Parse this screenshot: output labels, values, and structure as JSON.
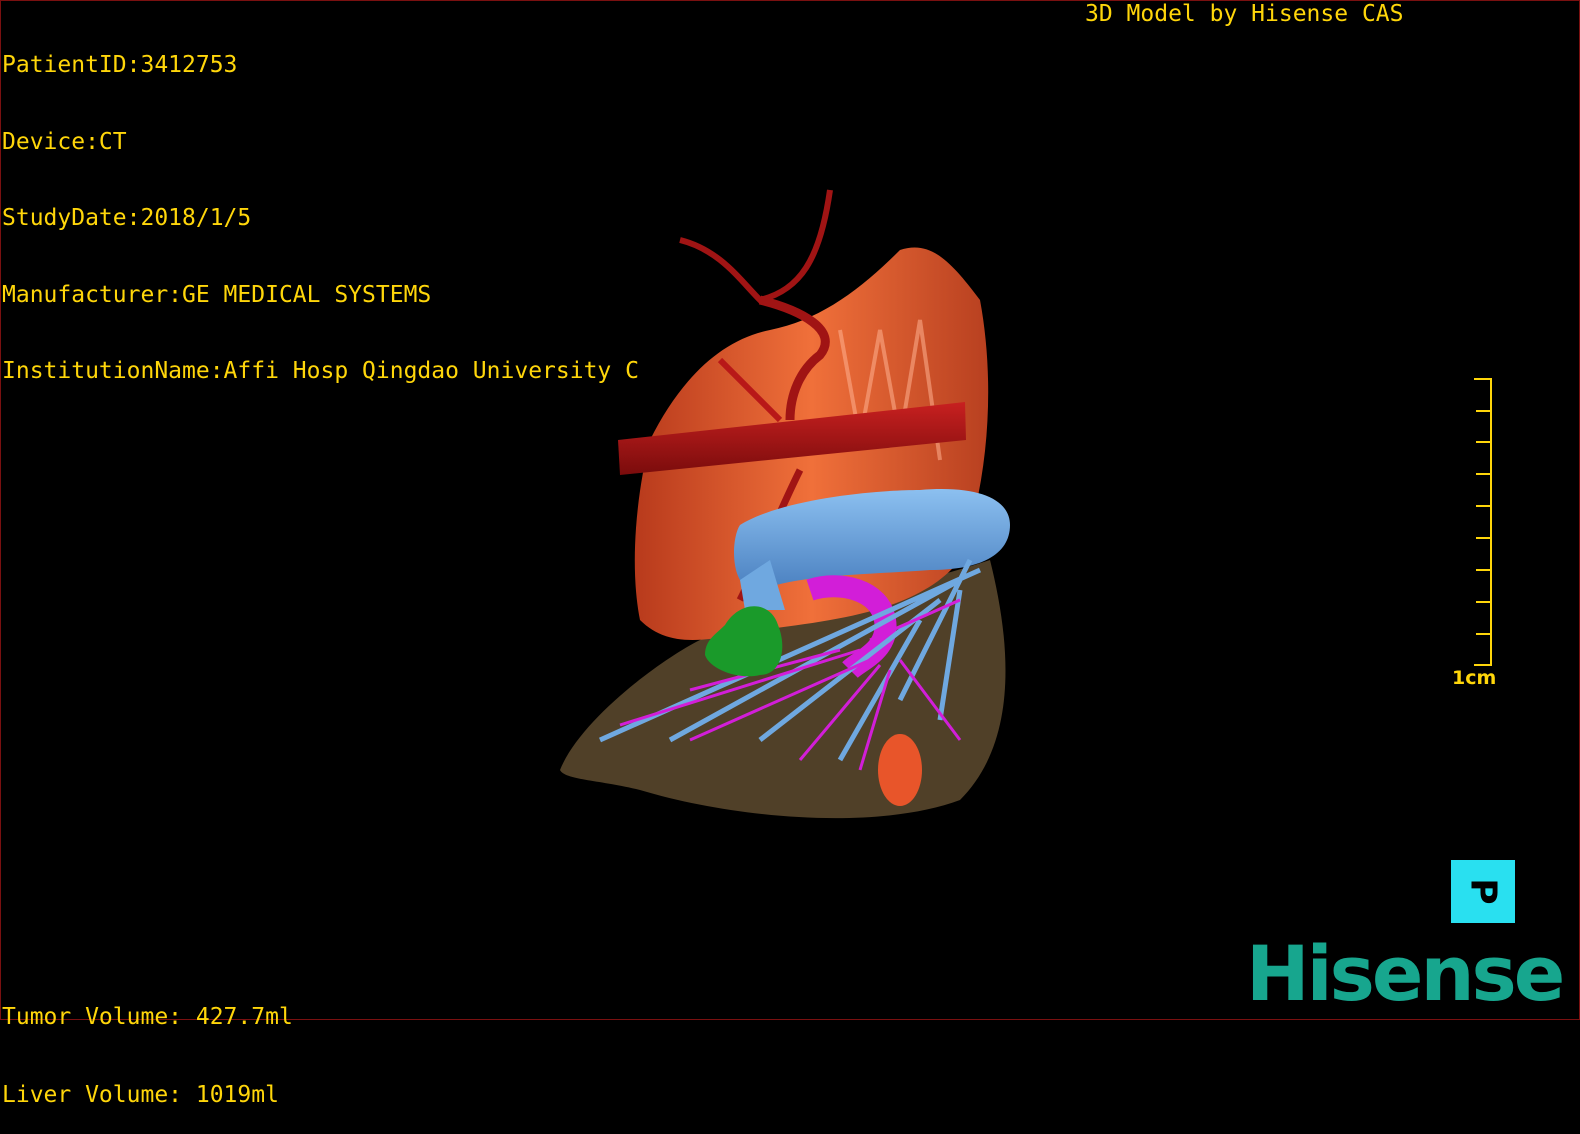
{
  "header": {
    "patient_id": "PatientID:3412753",
    "device": "Device:CT",
    "study_date": "StudyDate:2018/1/5",
    "manufacturer": "Manufacturer:GE MEDICAL SYSTEMS",
    "institution": "InstitutionName:Affi Hosp Qingdao University C",
    "credit": "3D Model by Hisense CAS"
  },
  "volumes": {
    "tumor": "Tumor Volume: 427.7ml",
    "liver": "Liver Volume: 1019ml"
  },
  "scale_bar": {
    "label": "1cm"
  },
  "orientation_marker": {
    "label": "P"
  },
  "brand": {
    "logo_text": "Hisense",
    "color": "#17a68e"
  },
  "colors": {
    "overlay_text": "#ffd60a",
    "liver": "#d8562e",
    "artery": "#a01414",
    "portal_vein": "#6fa8e0",
    "hepatic_vein": "#d21ed8",
    "gallbladder": "#1a9a2a",
    "tumor": "#e8552a",
    "orientation_cube": "#29e0f0"
  },
  "icons": {
    "orientation": "orientation-cube-icon",
    "scale": "scale-bar-icon"
  }
}
